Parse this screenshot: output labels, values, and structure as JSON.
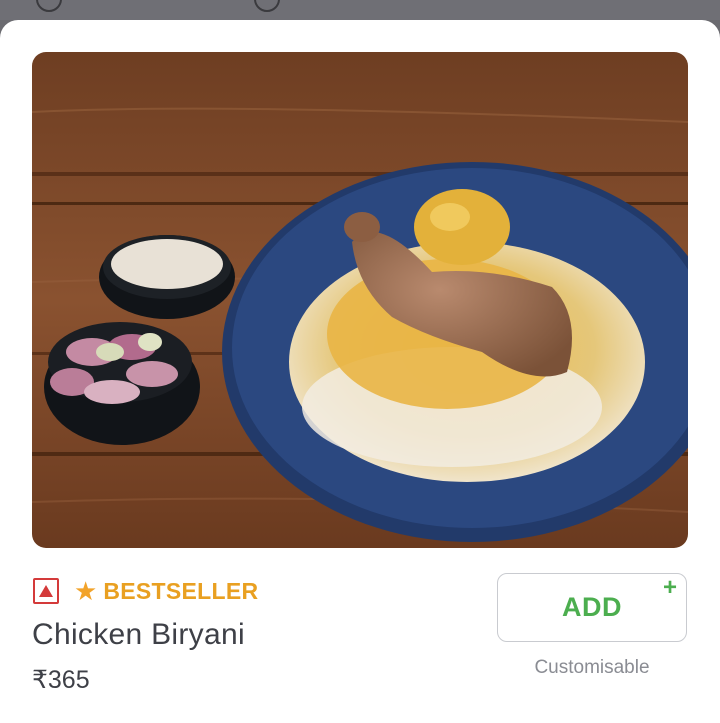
{
  "item": {
    "badge": "BESTSELLER",
    "name": "Chicken Biryani",
    "price": "₹365",
    "add_label": "ADD",
    "add_plus": "+",
    "customisable_note": "Customisable",
    "photo_alt": "Chicken Biryani"
  },
  "icons": {
    "veg_indicator": "non-veg-indicator-icon",
    "badge_icon": "star-icon",
    "add_plus": "plus-icon"
  },
  "colors": {
    "accent_green": "#4cae4f",
    "bestseller": "#e9a021",
    "nonveg_red": "#d43a3a"
  }
}
